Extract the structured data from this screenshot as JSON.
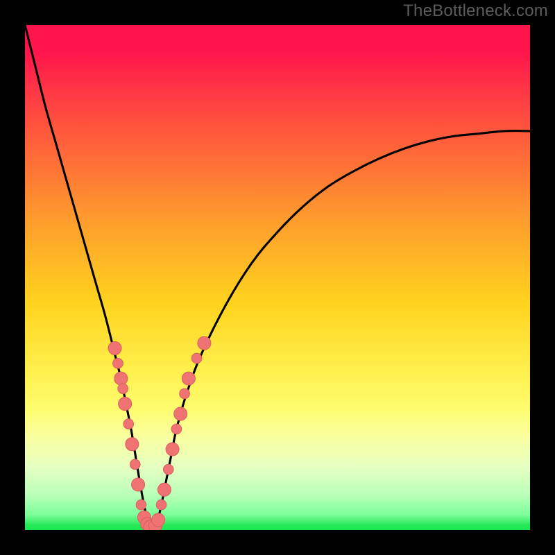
{
  "watermark": "TheBottleneck.com",
  "colors": {
    "frame": "#000000",
    "watermark": "#5c5c5c",
    "curve": "#000000",
    "marker_fill": "#f07373",
    "marker_stroke": "#db6060",
    "gradient_stops": [
      {
        "pct": 0,
        "hex": "#ff154c"
      },
      {
        "pct": 5,
        "hex": "#ff154c"
      },
      {
        "pct": 22,
        "hex": "#ff5b3c"
      },
      {
        "pct": 38,
        "hex": "#ff9a2e"
      },
      {
        "pct": 55,
        "hex": "#ffd31e"
      },
      {
        "pct": 68,
        "hex": "#ffee4c"
      },
      {
        "pct": 76,
        "hex": "#fffc6e"
      },
      {
        "pct": 82,
        "hex": "#f8ffa3"
      },
      {
        "pct": 88,
        "hex": "#e3ffc2"
      },
      {
        "pct": 93,
        "hex": "#b9ffb8"
      },
      {
        "pct": 97,
        "hex": "#7dff9a"
      },
      {
        "pct": 99,
        "hex": "#28e85a"
      },
      {
        "pct": 100,
        "hex": "#17e651"
      }
    ]
  },
  "chart_data": {
    "type": "line",
    "title": "",
    "xlabel": "",
    "ylabel": "",
    "xlim": [
      0,
      100
    ],
    "ylim": [
      0,
      100
    ],
    "series": [
      {
        "name": "bottleneck-curve",
        "x": [
          0,
          2,
          4,
          6,
          8,
          10,
          12,
          14,
          16,
          18,
          19,
          20,
          21,
          22,
          23,
          24,
          25,
          26,
          27,
          28,
          29,
          30,
          32,
          35,
          40,
          45,
          50,
          55,
          60,
          65,
          70,
          75,
          80,
          85,
          90,
          95,
          100
        ],
        "y": [
          100,
          92,
          84,
          77,
          70,
          63,
          56,
          49,
          42,
          34,
          30,
          25,
          20,
          14,
          8,
          3,
          0,
          1,
          5,
          10,
          15,
          20,
          27,
          35,
          45,
          53,
          59,
          64,
          68,
          71,
          73.5,
          75.5,
          77,
          78,
          78.5,
          79,
          79
        ]
      }
    ],
    "scatter_points": [
      {
        "x": 17.8,
        "y": 36,
        "r": 1.3
      },
      {
        "x": 18.4,
        "y": 33,
        "r": 1.0
      },
      {
        "x": 19.0,
        "y": 30,
        "r": 1.3
      },
      {
        "x": 19.4,
        "y": 28,
        "r": 1.0
      },
      {
        "x": 19.8,
        "y": 25,
        "r": 1.3
      },
      {
        "x": 20.5,
        "y": 21,
        "r": 1.0
      },
      {
        "x": 21.2,
        "y": 17,
        "r": 1.3
      },
      {
        "x": 21.8,
        "y": 13,
        "r": 1.0
      },
      {
        "x": 22.4,
        "y": 9,
        "r": 1.3
      },
      {
        "x": 23.0,
        "y": 5,
        "r": 1.0
      },
      {
        "x": 23.6,
        "y": 2.5,
        "r": 1.3
      },
      {
        "x": 24.2,
        "y": 1.2,
        "r": 1.3
      },
      {
        "x": 25.0,
        "y": 0.5,
        "r": 1.5
      },
      {
        "x": 25.8,
        "y": 0.8,
        "r": 1.3
      },
      {
        "x": 26.4,
        "y": 2,
        "r": 1.3
      },
      {
        "x": 27.0,
        "y": 5,
        "r": 1.0
      },
      {
        "x": 27.6,
        "y": 8,
        "r": 1.3
      },
      {
        "x": 28.4,
        "y": 12,
        "r": 1.0
      },
      {
        "x": 29.2,
        "y": 16,
        "r": 1.3
      },
      {
        "x": 30.0,
        "y": 20,
        "r": 1.0
      },
      {
        "x": 30.8,
        "y": 23,
        "r": 1.3
      },
      {
        "x": 31.6,
        "y": 27,
        "r": 1.0
      },
      {
        "x": 32.4,
        "y": 30,
        "r": 1.3
      },
      {
        "x": 34.0,
        "y": 34,
        "r": 1.0
      },
      {
        "x": 35.5,
        "y": 37,
        "r": 1.3
      }
    ]
  }
}
